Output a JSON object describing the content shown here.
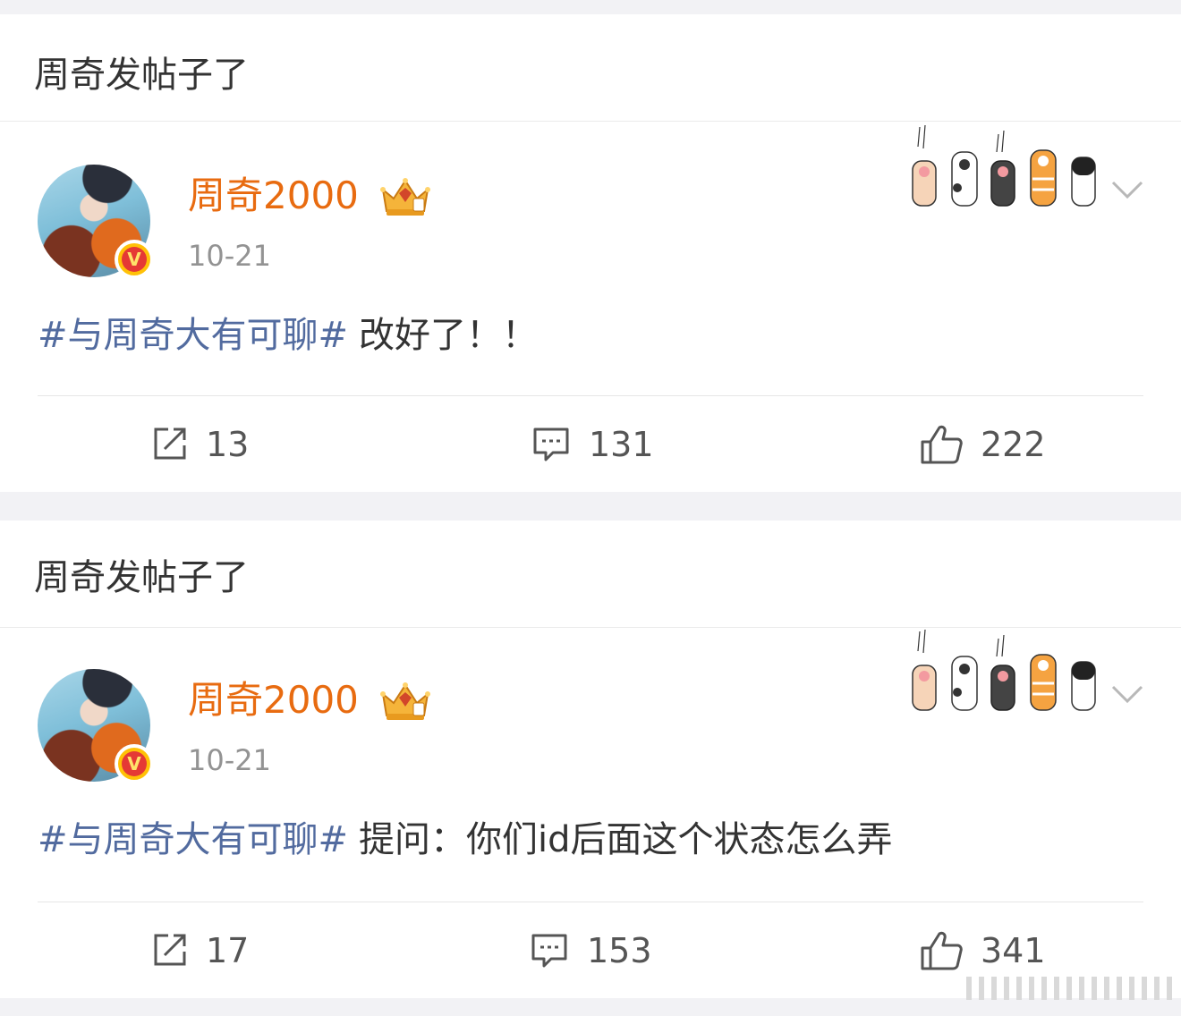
{
  "colors": {
    "background": "#f2f2f5",
    "username": "#e86b10",
    "hashtag": "#526b9f",
    "text": "#333333",
    "meta": "#939393",
    "verified_badge": "#ffc107"
  },
  "posts": [
    {
      "header": "周奇发帖子了",
      "user": {
        "name": "周奇2000",
        "avatar_icon": "avatar",
        "verified_icon": "verified-v-icon",
        "vip_icon": "crown-icon"
      },
      "date": "10-21",
      "hashtag": "#与周奇大有可聊#",
      "text": "改好了！！",
      "decoration_icon": "cat-paws-icon",
      "menu_icon": "chevron-down-icon",
      "actions": {
        "repost": "13",
        "comment": "131",
        "like": "222"
      }
    },
    {
      "header": "周奇发帖子了",
      "user": {
        "name": "周奇2000",
        "avatar_icon": "avatar",
        "verified_icon": "verified-v-icon",
        "vip_icon": "crown-icon"
      },
      "date": "10-21",
      "hashtag": "#与周奇大有可聊#",
      "text": "提问：你们id后面这个状态怎么弄",
      "decoration_icon": "cat-paws-icon",
      "menu_icon": "chevron-down-icon",
      "actions": {
        "repost": "17",
        "comment": "153",
        "like": "341"
      }
    }
  ],
  "verified_letter": "V"
}
